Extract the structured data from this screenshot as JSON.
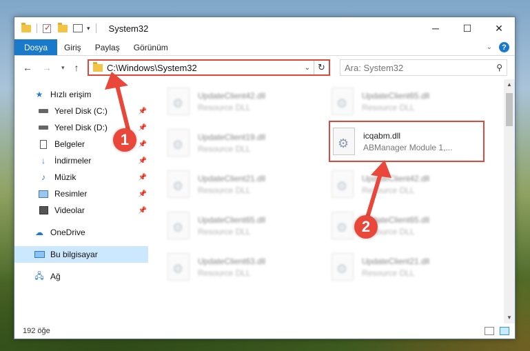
{
  "window": {
    "title": "System32",
    "controls": {
      "minimize": "─",
      "maximize": "☐",
      "close": "✕"
    }
  },
  "ribbon": {
    "tabs": [
      "Dosya",
      "Giriş",
      "Paylaş",
      "Görünüm"
    ],
    "help": "?"
  },
  "address": {
    "path": "C:\\Windows\\System32",
    "search_placeholder": "Ara: System32"
  },
  "sidebar": {
    "items": [
      {
        "label": "Hızlı erişim",
        "icon": "star-icon",
        "pinned": false
      },
      {
        "label": "Yerel Disk (C:)",
        "icon": "drive-icon",
        "pinned": true
      },
      {
        "label": "Yerel Disk (D:)",
        "icon": "drive-icon",
        "pinned": true
      },
      {
        "label": "Belgeler",
        "icon": "document-icon",
        "pinned": true
      },
      {
        "label": "İndirmeler",
        "icon": "download-icon",
        "pinned": true
      },
      {
        "label": "Müzik",
        "icon": "music-icon",
        "pinned": true
      },
      {
        "label": "Resimler",
        "icon": "picture-icon",
        "pinned": true
      },
      {
        "label": "Videolar",
        "icon": "video-icon",
        "pinned": true
      },
      {
        "label": "OneDrive",
        "icon": "cloud-icon",
        "pinned": false
      },
      {
        "label": "Bu bilgisayar",
        "icon": "computer-icon",
        "pinned": false,
        "selected": true
      },
      {
        "label": "Ağ",
        "icon": "network-icon",
        "pinned": false
      }
    ]
  },
  "files": {
    "left_column": [
      {
        "name": "UpdateClient42.dll",
        "type": "Resource DLL"
      },
      {
        "name": "UpdateClient19.dll",
        "type": "Resource DLL"
      },
      {
        "name": "UpdateClient21.dll",
        "type": "Resource DLL"
      },
      {
        "name": "UpdateClient65.dll",
        "type": "Resource DLL"
      },
      {
        "name": "UpdateClient63.dll",
        "type": "Resource DLL"
      }
    ],
    "right_column": [
      {
        "name": "UpdateClient65.dll",
        "type": "Resource DLL"
      },
      {
        "name": "icqabm.dll",
        "type": "ABManager Module 1,...",
        "highlighted": true
      },
      {
        "name": "UpdateClient42.dll",
        "type": "Resource DLL"
      },
      {
        "name": "UpdateClient65.dll",
        "type": "Resource DLL"
      },
      {
        "name": "UpdateClient21.dll",
        "type": "Resource DLL"
      }
    ]
  },
  "status": {
    "count": "192 öğe"
  },
  "markers": {
    "one": "1",
    "two": "2"
  },
  "colors": {
    "accent": "#1979ca",
    "highlight": "#e0473a",
    "selected": "#cce8ff"
  }
}
